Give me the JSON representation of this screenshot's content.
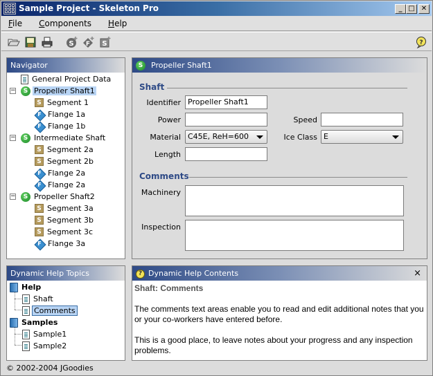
{
  "window": {
    "title": "Sample Project - Skeleton Pro",
    "controls": [
      "minimize",
      "maximize",
      "close"
    ]
  },
  "menubar": {
    "items": [
      {
        "label": "File",
        "mnemonic": "F"
      },
      {
        "label": "Components",
        "mnemonic": "C"
      },
      {
        "label": "Help",
        "mnemonic": "H"
      }
    ]
  },
  "toolbar": {
    "buttons": [
      "open-folder-icon",
      "save-disk-icon",
      "print-icon",
      "new-shaft-icon",
      "new-flange-icon",
      "new-segment-icon"
    ],
    "help_button": "help-icon"
  },
  "navigator": {
    "title": "Navigator",
    "items": [
      {
        "label": "General Project Data",
        "type": "document",
        "level": 1
      },
      {
        "label": "Propeller Shaft1",
        "type": "shaft",
        "level": 0,
        "expanded": true,
        "selected": true
      },
      {
        "label": "Segment 1",
        "type": "segment",
        "level": 1
      },
      {
        "label": "Flange 1a",
        "type": "flange",
        "level": 1
      },
      {
        "label": "Flange 1b",
        "type": "flange",
        "level": 1
      },
      {
        "label": "Intermediate Shaft",
        "type": "shaft",
        "level": 0,
        "expanded": true
      },
      {
        "label": "Segment 2a",
        "type": "segment",
        "level": 1
      },
      {
        "label": "Segment 2b",
        "type": "segment",
        "level": 1
      },
      {
        "label": "Flange 2a",
        "type": "flange",
        "level": 1
      },
      {
        "label": "Flange 2a",
        "type": "flange",
        "level": 1
      },
      {
        "label": "Propeller Shaft2",
        "type": "shaft",
        "level": 0,
        "expanded": true
      },
      {
        "label": "Segment 3a",
        "type": "segment",
        "level": 1
      },
      {
        "label": "Segment 3b",
        "type": "segment",
        "level": 1
      },
      {
        "label": "Segment 3c",
        "type": "segment",
        "level": 1
      },
      {
        "label": "Flange 3a",
        "type": "flange",
        "level": 1
      }
    ]
  },
  "editor": {
    "title": "Propeller Shaft1",
    "icon_letter": "S",
    "shaft_section": "Shaft",
    "fields": {
      "identifier": {
        "label": "Identifier",
        "value": "Propeller Shaft1"
      },
      "power": {
        "label": "Power",
        "value": ""
      },
      "speed": {
        "label": "Speed",
        "value": ""
      },
      "material": {
        "label": "Material",
        "value": "C45E, ReH=600"
      },
      "ice_class": {
        "label": "Ice Class",
        "value": "E"
      },
      "length": {
        "label": "Length",
        "value": ""
      }
    },
    "comments_section": "Comments",
    "comments": {
      "machinery": {
        "label": "Machinery",
        "value": ""
      },
      "inspection": {
        "label": "Inspection",
        "value": ""
      }
    }
  },
  "help_topics": {
    "title": "Dynamic Help Topics",
    "groups": [
      {
        "label": "Help",
        "items": [
          {
            "label": "Shaft"
          },
          {
            "label": "Comments",
            "selected": true
          }
        ]
      },
      {
        "label": "Samples",
        "items": [
          {
            "label": "Sample1"
          },
          {
            "label": "Sample2"
          }
        ]
      }
    ]
  },
  "help_contents": {
    "title": "Dynamic Help Contents",
    "heading": "Shaft: Comments",
    "paragraphs": [
      "The comments text areas enable you to read and edit additional notes that you or your co-workers have entered before.",
      "This is a good place, to leave notes about your progress and any inspection problems."
    ],
    "close_label": "×"
  },
  "status": {
    "text": "© 2002-2004 JGoodies"
  },
  "icon_letters": {
    "shaft": "S",
    "segment": "S",
    "flange": "F",
    "help": "?"
  }
}
